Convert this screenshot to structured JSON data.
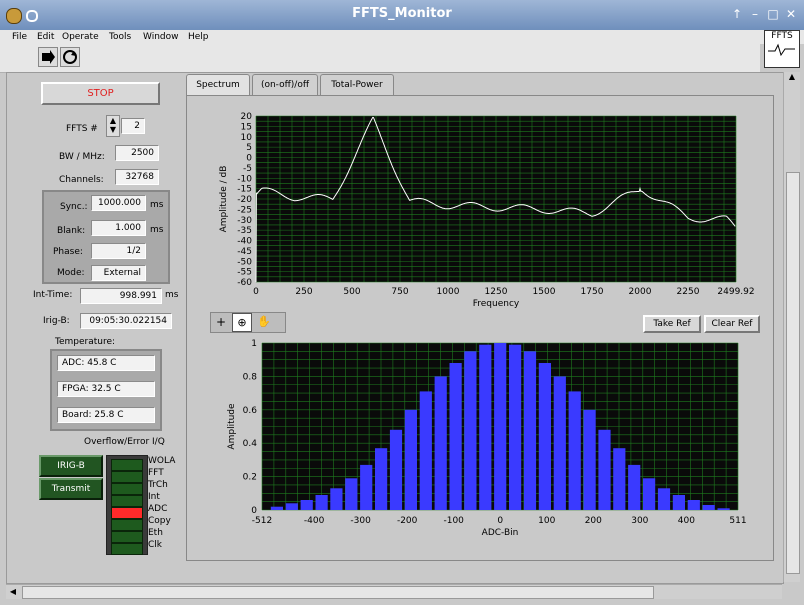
{
  "window": {
    "title": "FFTS_Monitor"
  },
  "menu": [
    "File",
    "Edit",
    "Operate",
    "Tools",
    "Window",
    "Help"
  ],
  "ffts_badge": "FFTS",
  "controls": {
    "stop_label": "STOP",
    "ffts_num_label": "FFTS #",
    "ffts_num": "2",
    "bw_label": "BW / MHz:",
    "bw": "2500",
    "channels_label": "Channels:",
    "channels": "32768",
    "sync_label": "Sync.:",
    "sync": "1000.000",
    "blank_label": "Blank:",
    "blank": "1.000",
    "phase_label": "Phase:",
    "phase": "1/2",
    "mode_label": "Mode:",
    "mode": "External",
    "unit_ms": "ms",
    "inttime_label": "Int-Time:",
    "inttime": "998.991",
    "irigb_label": "Irig-B:",
    "irigb": "09:05:30.022154",
    "temperature_label": "Temperature:",
    "adc_temp": "ADC: 45.8 C",
    "fpga_temp": "FPGA: 32.5 C",
    "board_temp": "Board: 25.8 C",
    "overflow_label": "Overflow/Error I/Q",
    "irigb_button": "IRIG-B",
    "transmit_button": "Transmit",
    "leds": [
      {
        "label": "WOLA",
        "on": false
      },
      {
        "label": "FFT",
        "on": false
      },
      {
        "label": "TrCh",
        "on": false
      },
      {
        "label": "Int",
        "on": false
      },
      {
        "label": "ADC",
        "on": true
      },
      {
        "label": "Copy",
        "on": false
      },
      {
        "label": "Eth",
        "on": false
      },
      {
        "label": "Clk",
        "on": false
      }
    ]
  },
  "tabs": [
    "Spectrum",
    "(on-off)/off",
    "Total-Power"
  ],
  "spectrum_buttons": {
    "take_ref": "Take Ref",
    "clear_ref": "Clear Ref"
  },
  "colors": {
    "plot_bg": "#0a0a0a",
    "grid": "#1f7a1f",
    "trace": "#ffffff",
    "bars": "#3a3aff",
    "led_on": "#ff2a2a",
    "led_off": "#1e5a1e",
    "stop_text": "#e02020"
  },
  "chart_data": [
    {
      "type": "line",
      "xlabel": "Frequency",
      "ylabel": "Amplitude / dB",
      "xlim": [
        0,
        2499.92
      ],
      "ylim": [
        -60,
        20
      ],
      "x_ticks": [
        "0",
        "250",
        "500",
        "750",
        "1000",
        "1250",
        "1500",
        "1750",
        "2000",
        "2250",
        "2499.92"
      ],
      "y_ticks": [
        "20",
        "15",
        "10",
        "5",
        "0",
        "-5",
        "-10",
        "-15",
        "-20",
        "-25",
        "-30",
        "-35",
        "-40",
        "-45",
        "-50",
        "-55",
        "-60"
      ],
      "grid": true,
      "series": [
        {
          "x": [
            0,
            30,
            200,
            400,
            600,
            610,
            800,
            1000,
            1250,
            1500,
            1750,
            2000,
            2010,
            2250,
            2450,
            2499.92
          ],
          "y": [
            -18,
            -16,
            -19,
            -20,
            -19,
            18,
            -21,
            -23,
            -24,
            -25,
            -27,
            -28,
            -15,
            -29,
            -30,
            -34
          ]
        }
      ],
      "spikes": [
        {
          "x": 600,
          "y": 18
        },
        {
          "x": 2000,
          "y": -15
        }
      ]
    },
    {
      "type": "bar",
      "xlabel": "ADC-Bin",
      "ylabel": "Amplitude",
      "xlim": [
        -512,
        511
      ],
      "ylim": [
        0,
        1
      ],
      "x_ticks": [
        "-512",
        "-400",
        "-300",
        "-200",
        "-100",
        "0",
        "100",
        "200",
        "300",
        "400",
        "511"
      ],
      "y_ticks": [
        "1",
        "0.8",
        "0.6",
        "0.4",
        "0.2",
        "0"
      ],
      "grid": true,
      "categories": [
        -480,
        -448,
        -416,
        -384,
        -352,
        -320,
        -288,
        -256,
        -224,
        -192,
        -160,
        -128,
        -96,
        -64,
        -32,
        0,
        32,
        64,
        96,
        128,
        160,
        192,
        224,
        256,
        288,
        320,
        352,
        384,
        416,
        448,
        480
      ],
      "values": [
        0.02,
        0.04,
        0.06,
        0.09,
        0.13,
        0.19,
        0.27,
        0.37,
        0.48,
        0.6,
        0.71,
        0.8,
        0.88,
        0.95,
        0.99,
        1.0,
        0.99,
        0.95,
        0.88,
        0.8,
        0.71,
        0.6,
        0.48,
        0.37,
        0.27,
        0.19,
        0.13,
        0.09,
        0.06,
        0.03,
        0.01
      ]
    }
  ]
}
